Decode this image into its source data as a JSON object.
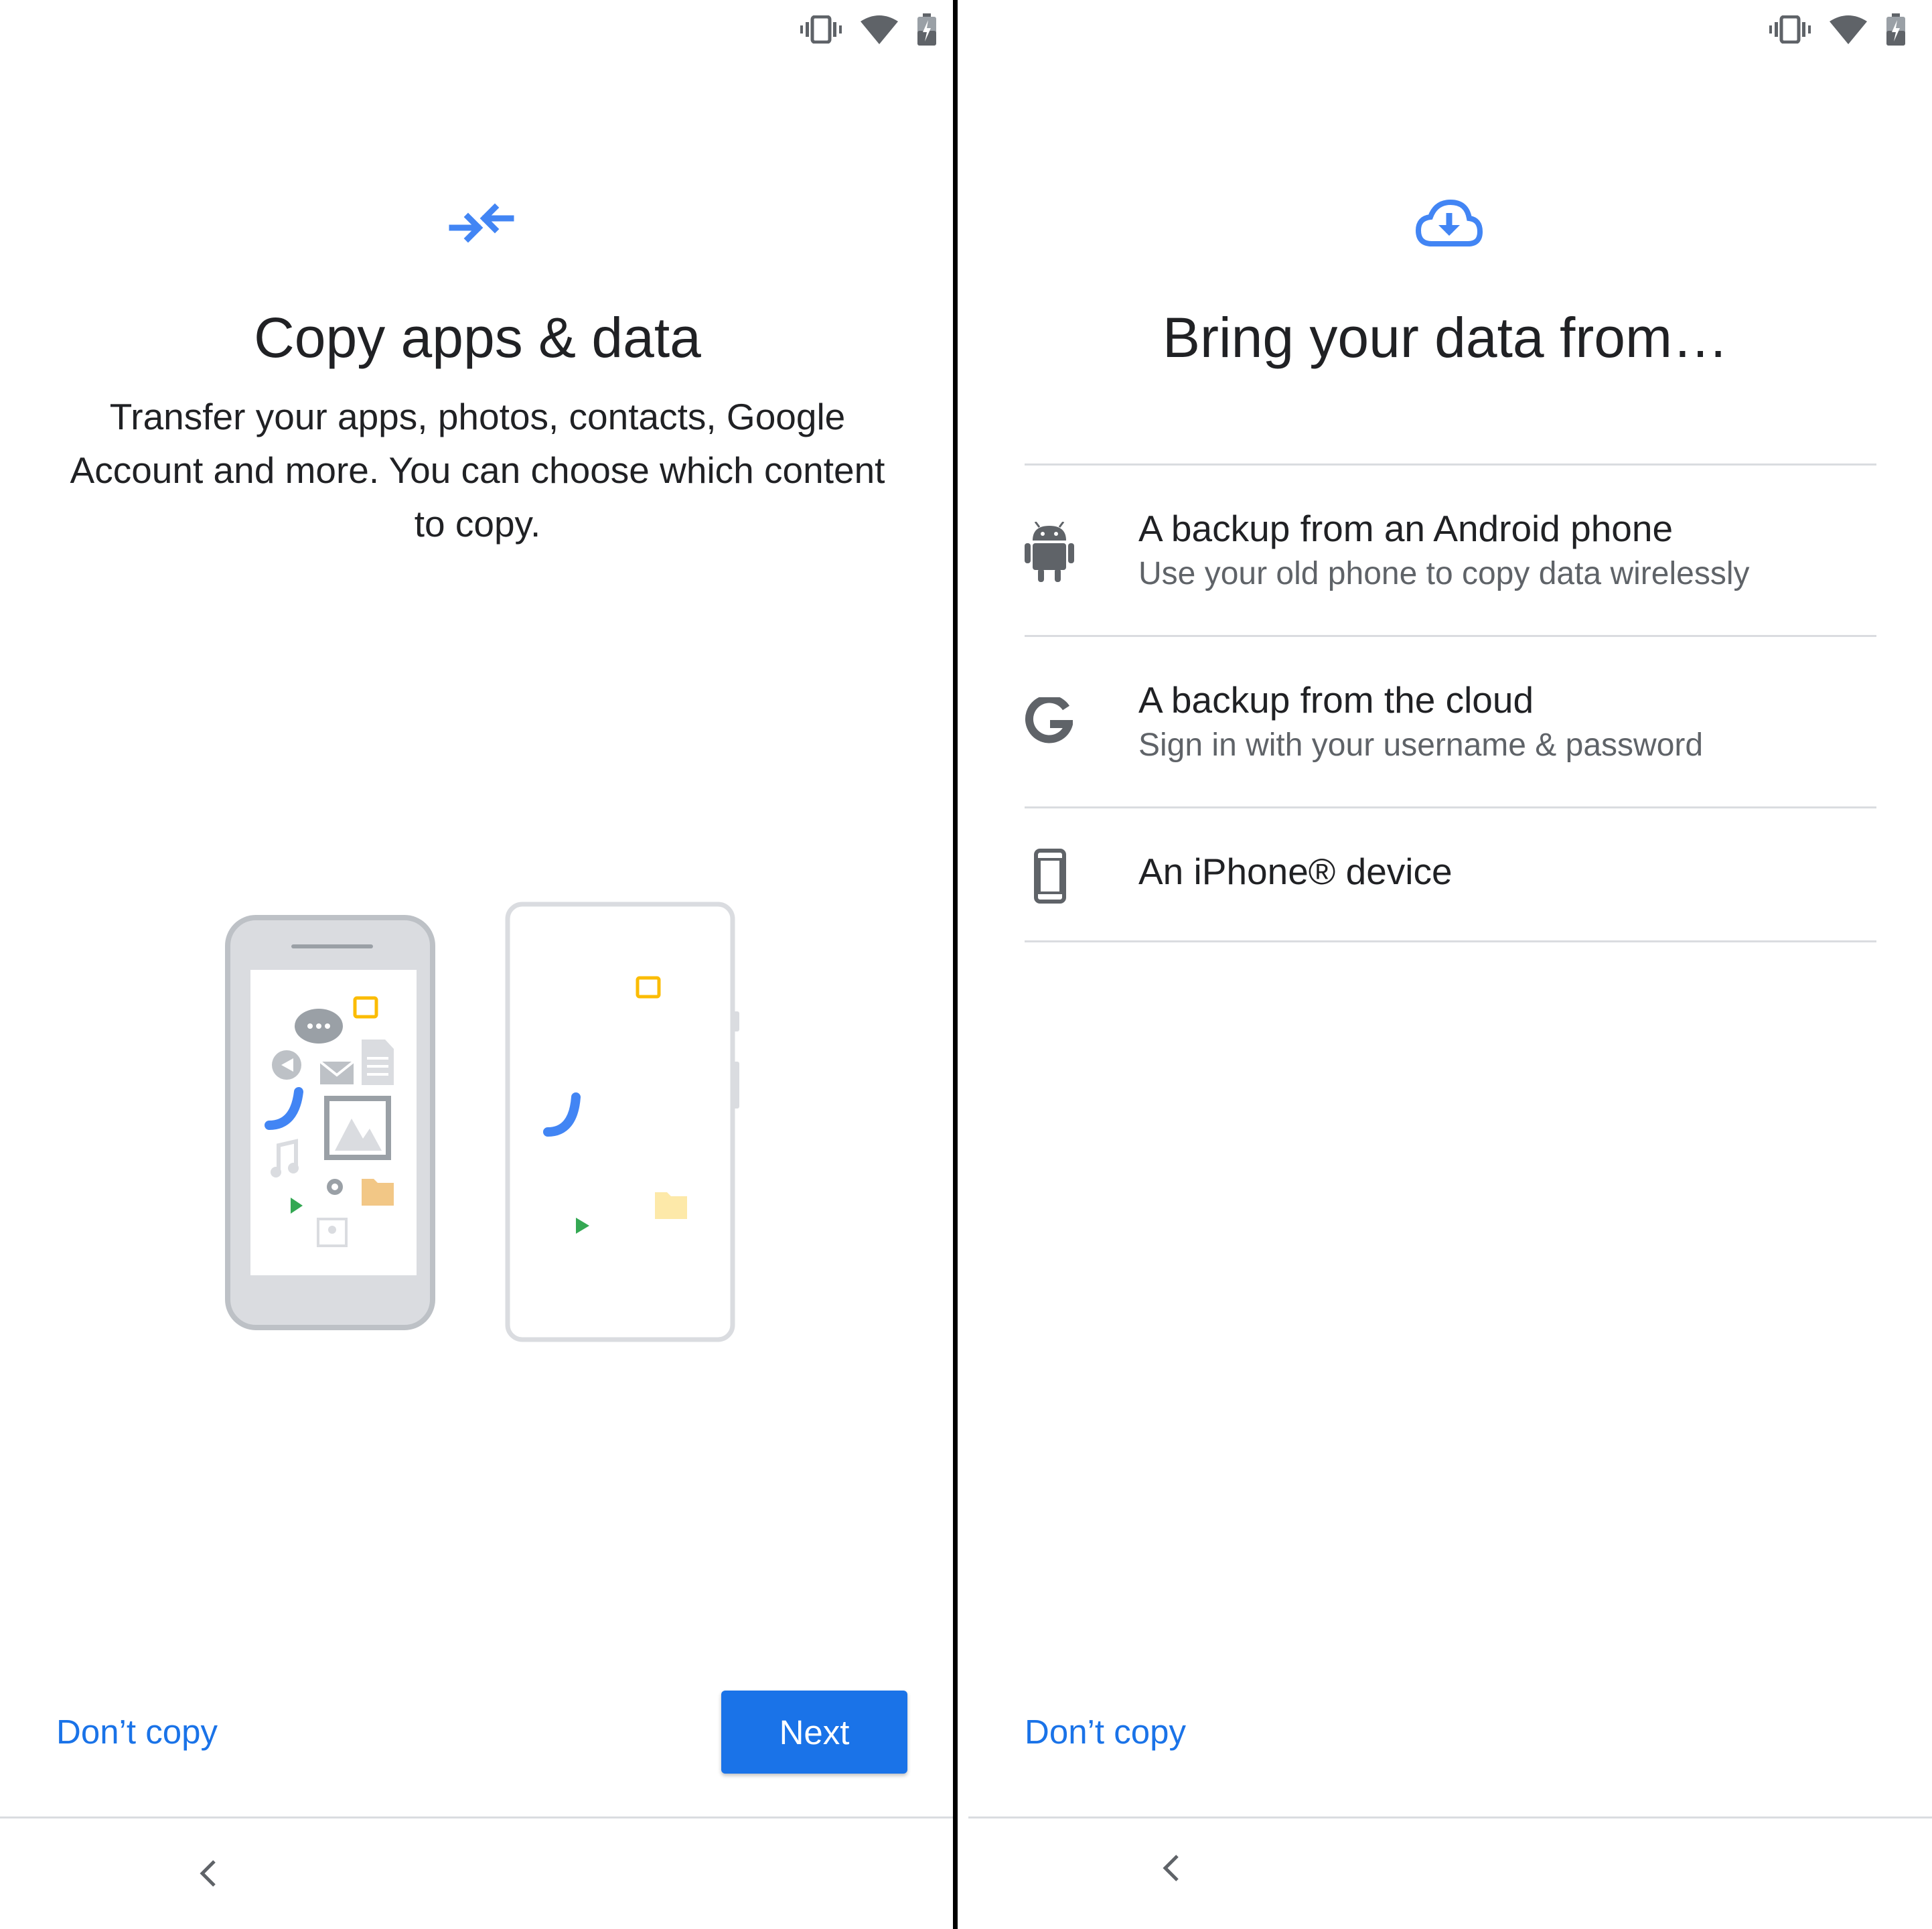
{
  "left": {
    "title": "Copy apps & data",
    "description": "Transfer your apps, photos, contacts, Google Account and more. You can choose which content to copy.",
    "dont_copy_label": "Don’t copy",
    "next_label": "Next"
  },
  "right": {
    "title": "Bring your data from…",
    "options": [
      {
        "title": "A backup from an Android phone",
        "subtitle": "Use your old phone to copy data wirelessly",
        "icon": "android-icon"
      },
      {
        "title": "A backup from the cloud",
        "subtitle": "Sign in with your username & password",
        "icon": "google-g-icon"
      },
      {
        "title": "An iPhone® device",
        "icon": "phone-icon"
      }
    ],
    "dont_copy_label": "Don’t copy"
  },
  "colors": {
    "accent": "#1a73e8",
    "text_primary": "#202124",
    "text_secondary": "#5f6368",
    "divider": "#dadce0"
  }
}
